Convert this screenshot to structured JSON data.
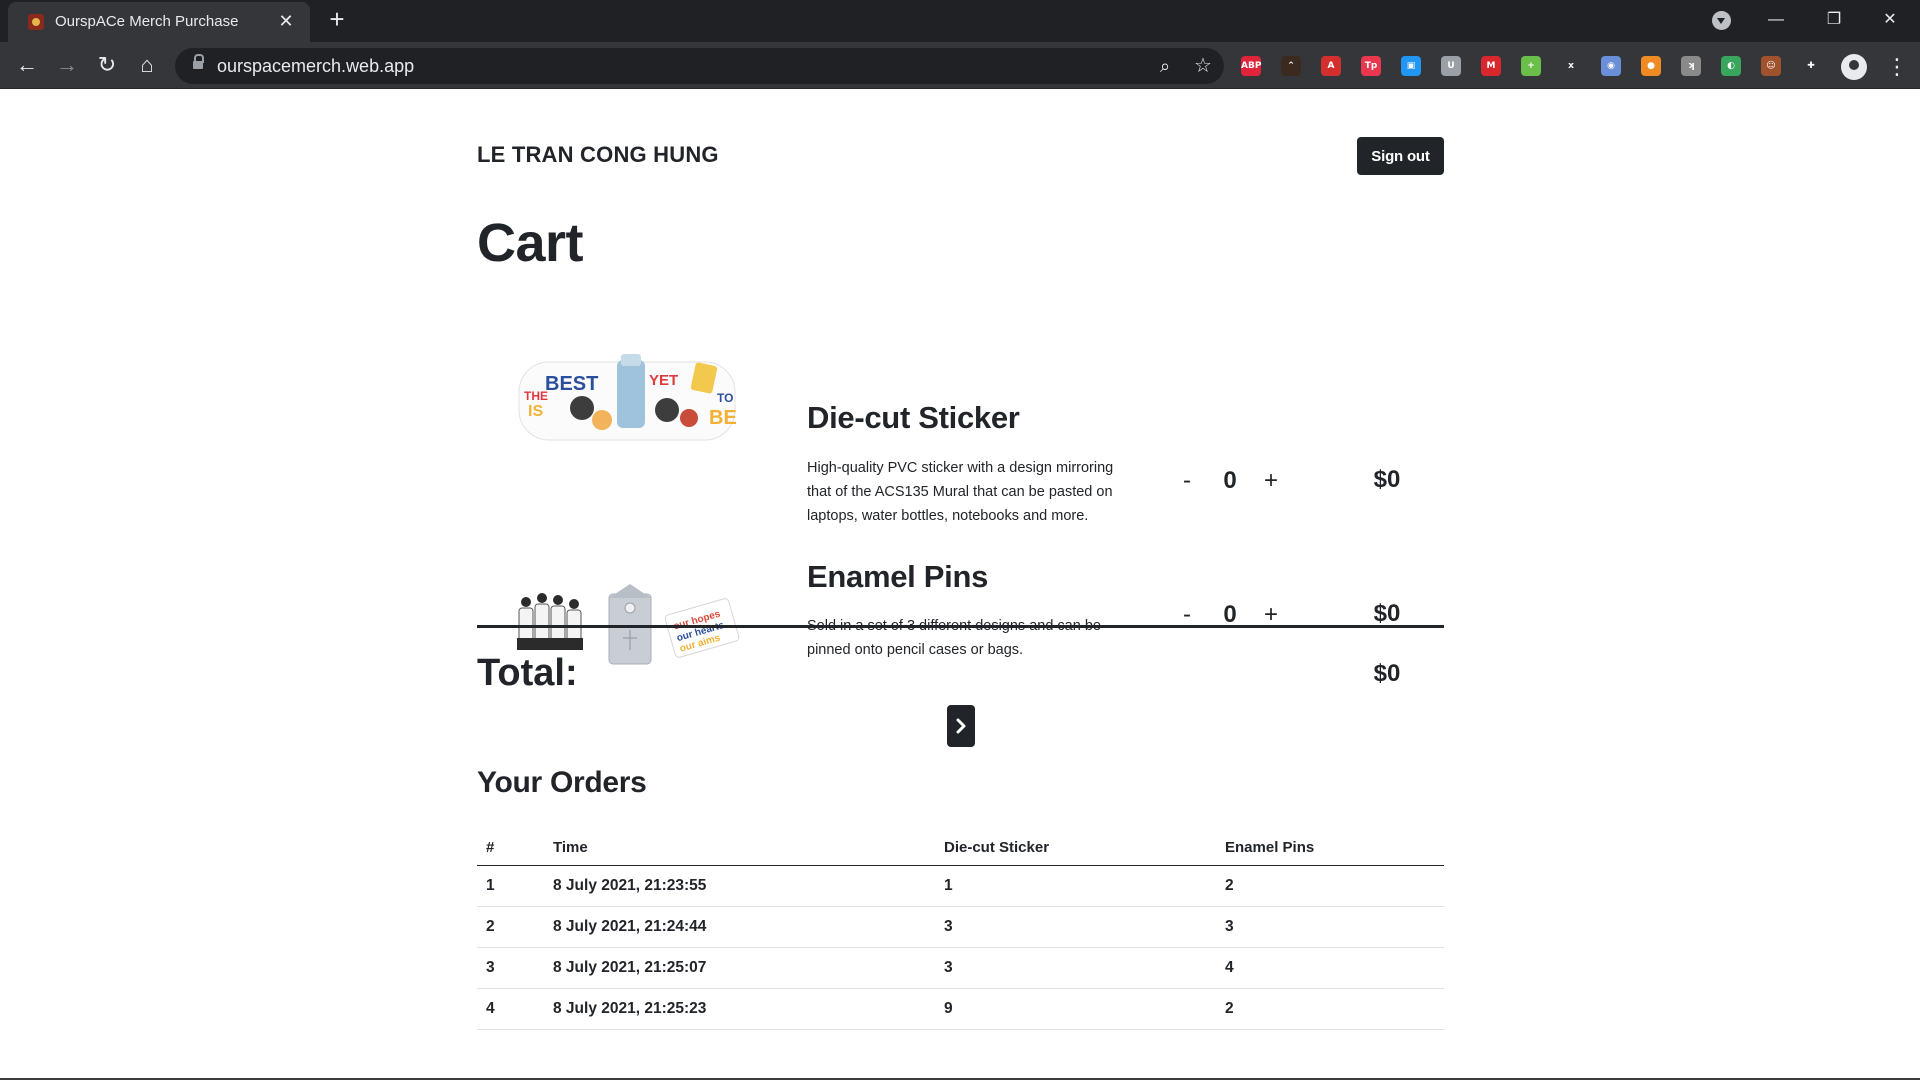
{
  "browser": {
    "tab_title": "OurspACe Merch Purchase",
    "url": "ourspacemerch.web.app",
    "extensions": [
      {
        "name": "adblock-plus-icon",
        "label": "ABP",
        "color": "#e0243b"
      },
      {
        "name": "extension-chevron-icon",
        "label": "⌃",
        "color": "#3a2a20"
      },
      {
        "name": "pdf-icon",
        "label": "A",
        "color": "#d32f2f"
      },
      {
        "name": "tp-icon",
        "label": "Tp",
        "color": "#e8374f"
      },
      {
        "name": "window-icon",
        "label": "▣",
        "color": "#2196f3"
      },
      {
        "name": "shield-icon",
        "label": "U",
        "color": "#9aa0a6"
      },
      {
        "name": "mega-icon",
        "label": "M",
        "color": "#d9272e"
      },
      {
        "name": "plus-circle-icon",
        "label": "+",
        "color": "#6abf4b"
      },
      {
        "name": "x-icon",
        "label": "x",
        "color": "#35363a"
      },
      {
        "name": "eyes-icon",
        "label": "◉",
        "color": "#6a8fd8"
      },
      {
        "name": "dot-icon",
        "label": "●",
        "color": "#f08a24"
      },
      {
        "name": "grey-box-icon",
        "label": "ʞ",
        "color": "#8a8a8a"
      },
      {
        "name": "palette-icon",
        "label": "◐",
        "color": "#3aa55c"
      },
      {
        "name": "face-icon",
        "label": "☺",
        "color": "#a0522d"
      },
      {
        "name": "puzzle-icon",
        "label": "✚",
        "color": "#35363a"
      }
    ]
  },
  "header": {
    "user_name": "LE TRAN CONG HUNG",
    "signout_label": "Sign out"
  },
  "cart": {
    "title": "Cart",
    "items": [
      {
        "title": "Die-cut Sticker",
        "description": "High-quality PVC sticker with a design mirroring that of the ACS135 Mural that can be pasted on laptops, water bottles, notebooks and more.",
        "quantity": "0",
        "minus": "-",
        "plus": "+",
        "price": "$0",
        "image_text": {
          "the": "THE",
          "best": "BEST",
          "is": "IS",
          "yet": "YET",
          "to": "TO",
          "be": "BE"
        }
      },
      {
        "title": "Enamel Pins",
        "description": "Sold in a set of 3 different designs and can be pinned onto pencil cases or bags.",
        "quantity": "0",
        "minus": "-",
        "plus": "+",
        "price": "$0",
        "image_text": {
          "line1": "our hopes",
          "line2": "our hearts",
          "line3": "our aims"
        }
      }
    ],
    "total_label": "Total:",
    "total_value": "$0"
  },
  "orders": {
    "title": "Your Orders",
    "columns": [
      "#",
      "Time",
      "Die-cut Sticker",
      "Enamel Pins"
    ],
    "rows": [
      [
        "1",
        "8 July 2021, 21:23:55",
        "1",
        "2"
      ],
      [
        "2",
        "8 July 2021, 21:24:44",
        "3",
        "3"
      ],
      [
        "3",
        "8 July 2021, 21:25:07",
        "3",
        "4"
      ],
      [
        "4",
        "8 July 2021, 21:25:23",
        "9",
        "2"
      ]
    ]
  }
}
